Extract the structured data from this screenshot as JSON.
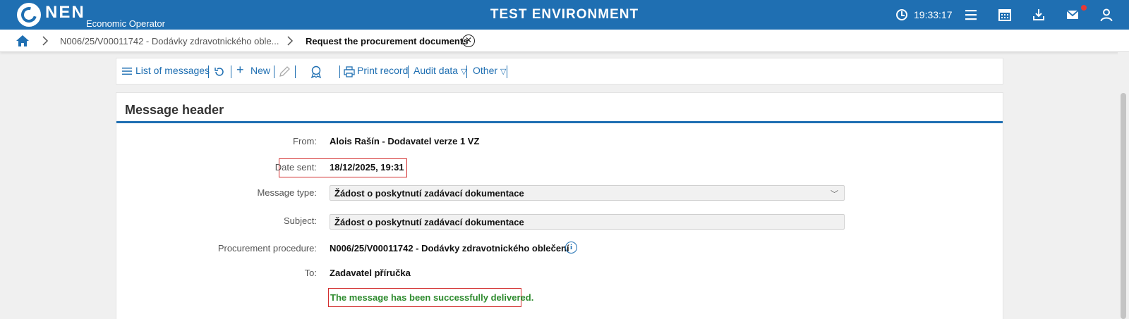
{
  "header": {
    "brand": "NEN",
    "subbrand": "Economic Operator",
    "environment": "TEST ENVIRONMENT",
    "time": "19:33:17"
  },
  "breadcrumb": {
    "items": [
      "N006/25/V00011742 - Dodávky zdravotnického oble...",
      "Request the procurement documents"
    ]
  },
  "toolbar": {
    "list_label": "List of messages",
    "new_label": "New",
    "print_label": "Print record",
    "audit_label": "Audit data",
    "other_label": "Other"
  },
  "message": {
    "title": "Message header",
    "from_label": "From:",
    "from_value": "Alois Rašín - Dodavatel verze 1 VZ",
    "date_label": "Date sent:",
    "date_value": "18/12/2025, 19:31",
    "type_label": "Message type:",
    "type_value": "Žádost o poskytnutí zadávací dokumentace",
    "subject_label": "Subject:",
    "subject_value": "Žádost o poskytnutí zadávací dokumentace",
    "procedure_label": "Procurement procedure:",
    "procedure_value": "N006/25/V00011742 - Dodávky zdravotnického oblečení",
    "to_label": "To:",
    "to_value": "Zadavatel příručka",
    "status": "The message has been successfully delivered."
  },
  "colors": {
    "brand": "#1f6fb2",
    "success": "#2e8b2e",
    "highlight_box": "#d32f2f"
  }
}
